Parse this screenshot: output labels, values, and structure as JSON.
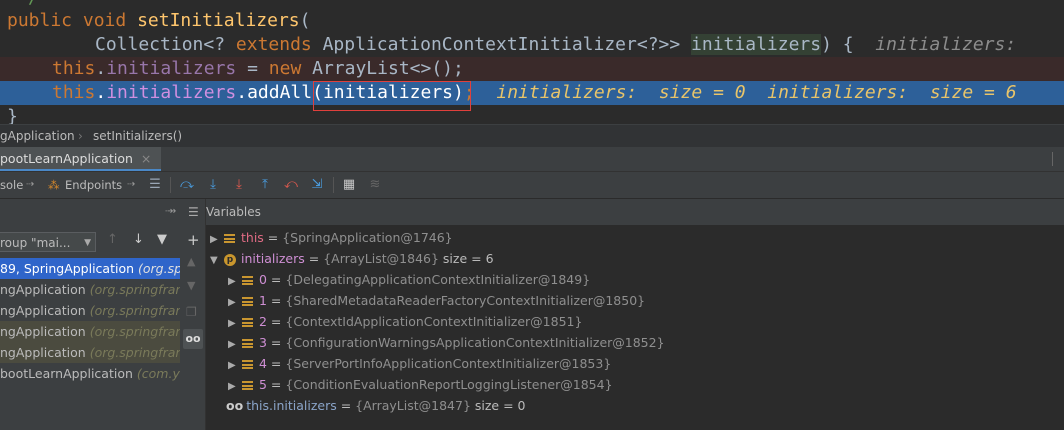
{
  "editor": {
    "line_top_fragment": "/",
    "l1": {
      "kw1": "public",
      "kw2": "void",
      "fn": "setInitializers",
      "rest": "("
    },
    "l2": {
      "t1": "Collection<? ",
      "kw": "extends",
      "t2": " ApplicationContextInitializer<?>> ",
      "param": "initializers",
      "t3": ") {",
      "hint": "initializers:"
    },
    "l3": {
      "kw": "this",
      "dot": ".",
      "field": "initializers",
      "t1": " = ",
      "kw2": "new",
      "t2": " ArrayList<>();"
    },
    "l4": {
      "kw": "this",
      "dot": ".",
      "field": "initializers",
      "t1": ".addAll(initializers)",
      "semi": ";",
      "hint": "initializers:  size = 0  initializers:  size = 6"
    },
    "l5": "}"
  },
  "breadcrumb": {
    "item1": "gApplication",
    "sep": "›",
    "item2": "setInitializers()"
  },
  "tab": {
    "label": "pootLearnApplication",
    "close": "×"
  },
  "toolbar": {
    "console": "sole",
    "endpoints": "Endpoints"
  },
  "frames": {
    "thread": "roup \"mai...",
    "items": [
      {
        "main": "89, SpringApplication ",
        "pkg": "(org.spri"
      },
      {
        "main": "ngApplication ",
        "pkg": "(org.springframe"
      },
      {
        "main": "ngApplication ",
        "pkg": "(org.springframe"
      },
      {
        "main": "ngApplication ",
        "pkg": "(org.springframew"
      },
      {
        "main": "ngApplication ",
        "pkg": "(org.springframew"
      },
      {
        "main": "bootLearnApplication ",
        "pkg": "(com.yua"
      }
    ]
  },
  "variables": {
    "header": "Variables",
    "this": {
      "name": "this",
      "eq": " = ",
      "value": "{SpringApplication@1746}"
    },
    "initializers": {
      "name": "initializers",
      "eq": " = ",
      "value": "{ArrayList@1846}",
      "size": "size = 6"
    },
    "children": [
      {
        "name": "0",
        "value": "{DelegatingApplicationContextInitializer@1849}"
      },
      {
        "name": "1",
        "value": "{SharedMetadataReaderFactoryContextInitializer@1850}"
      },
      {
        "name": "2",
        "value": "{ContextIdApplicationContextInitializer@1851}"
      },
      {
        "name": "3",
        "value": "{ConfigurationWarningsApplicationContextInitializer@1852}"
      },
      {
        "name": "4",
        "value": "{ServerPortInfoApplicationContextInitializer@1853}"
      },
      {
        "name": "5",
        "value": "{ConditionEvaluationReportLoggingListener@1854}"
      }
    ],
    "watch": {
      "name": "this.initializers",
      "eq": " = ",
      "value": "{ArrayList@1847}",
      "size": "size = 0"
    }
  }
}
